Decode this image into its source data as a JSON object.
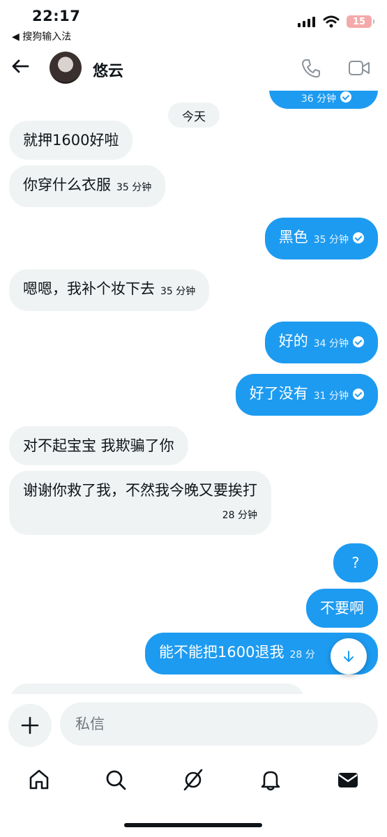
{
  "status": {
    "time": "22:17",
    "back_app": "◀ 搜狗输入法",
    "battery": "15"
  },
  "header": {
    "name": "悠云",
    "icons": [
      "back-arrow-icon",
      "phone-icon",
      "video-icon"
    ]
  },
  "chat": {
    "top_partial_meta": "36 分钟",
    "day_separator": "今天",
    "messages": [
      {
        "dir": "in",
        "text": "就押1600好啦",
        "meta": ""
      },
      {
        "dir": "in",
        "text": "你穿什么衣服",
        "meta": "35 分钟"
      },
      {
        "dir": "out",
        "text": "黑色",
        "meta": "35 分钟"
      },
      {
        "dir": "in",
        "text": "嗯嗯，我补个妆下去",
        "meta": "35 分钟"
      },
      {
        "dir": "out",
        "text": "好的",
        "meta": "34 分钟"
      },
      {
        "dir": "out",
        "text": "好了没有",
        "meta": "31 分钟"
      },
      {
        "dir": "in",
        "text": "对不起宝宝 我欺骗了你",
        "meta": ""
      },
      {
        "dir": "in",
        "text": "谢谢你救了我，不然我今晚又要挨打",
        "meta": "28 分钟"
      },
      {
        "dir": "out",
        "text": "?",
        "meta": ""
      },
      {
        "dir": "out",
        "text": "不要啊",
        "meta": ""
      },
      {
        "dir": "out",
        "text": "能不能把1600退我",
        "meta": "28 分"
      }
    ]
  },
  "composer": {
    "placeholder": "私信"
  },
  "nav": [
    "home-icon",
    "search-icon",
    "grok-icon",
    "notifications-icon",
    "messages-icon"
  ],
  "colors": {
    "accent": "#1d9bf0",
    "incoming_bubble": "#eff3f4",
    "battery_low": "#f4aaaa"
  }
}
